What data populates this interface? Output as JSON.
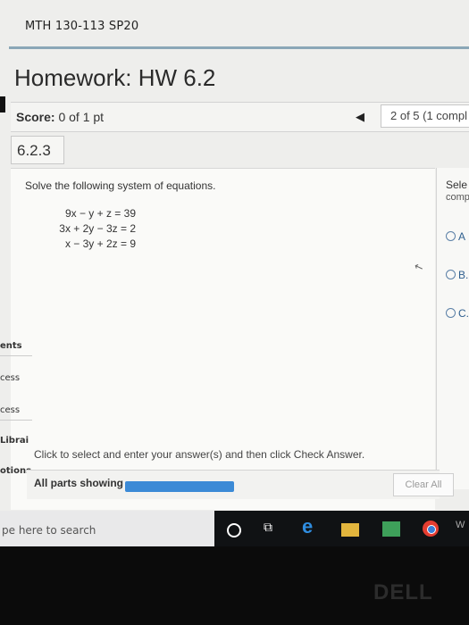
{
  "header": {
    "course": "MTH 130-113 SP20",
    "title": "Homework: HW 6.2"
  },
  "score": {
    "label": "Score:",
    "value": "0 of 1 pt"
  },
  "progress": {
    "prev_arrow": "◀",
    "text": "2 of 5 (1 compl"
  },
  "section": "6.2.3",
  "question": {
    "instruction": "Solve the following system of equations.",
    "equations": [
      "9x −   y +   z = 39",
      "3x + 2y − 3z = 2",
      "x − 3y + 2z = 9"
    ]
  },
  "right_panel": {
    "line1": "Sele",
    "line2": "comp",
    "options": [
      "A",
      "B.",
      "C."
    ]
  },
  "sidebar_fragments": [
    "ents",
    "cess",
    "cess",
    "Librai",
    "otions"
  ],
  "bottom": {
    "hint": "Click to select and enter your answer(s) and then click Check Answer.",
    "parts_label": "All parts showing",
    "parts_progress": 1.0,
    "clear_label": "Clear All"
  },
  "taskbar": {
    "search_text": "pe here to search",
    "icons": [
      "cortana-icon",
      "task-view-icon",
      "edge-icon",
      "file-explorer-icon",
      "store-icon",
      "chrome-icon"
    ],
    "edge_glyph": "e",
    "taskview_glyph": "⧉",
    "extra": "W"
  },
  "bezel": {
    "brand": "DELL"
  },
  "colors": {
    "accent": "#3c8ad6",
    "top_rule": "#8aa7b7",
    "option": "#2f5f8f"
  }
}
